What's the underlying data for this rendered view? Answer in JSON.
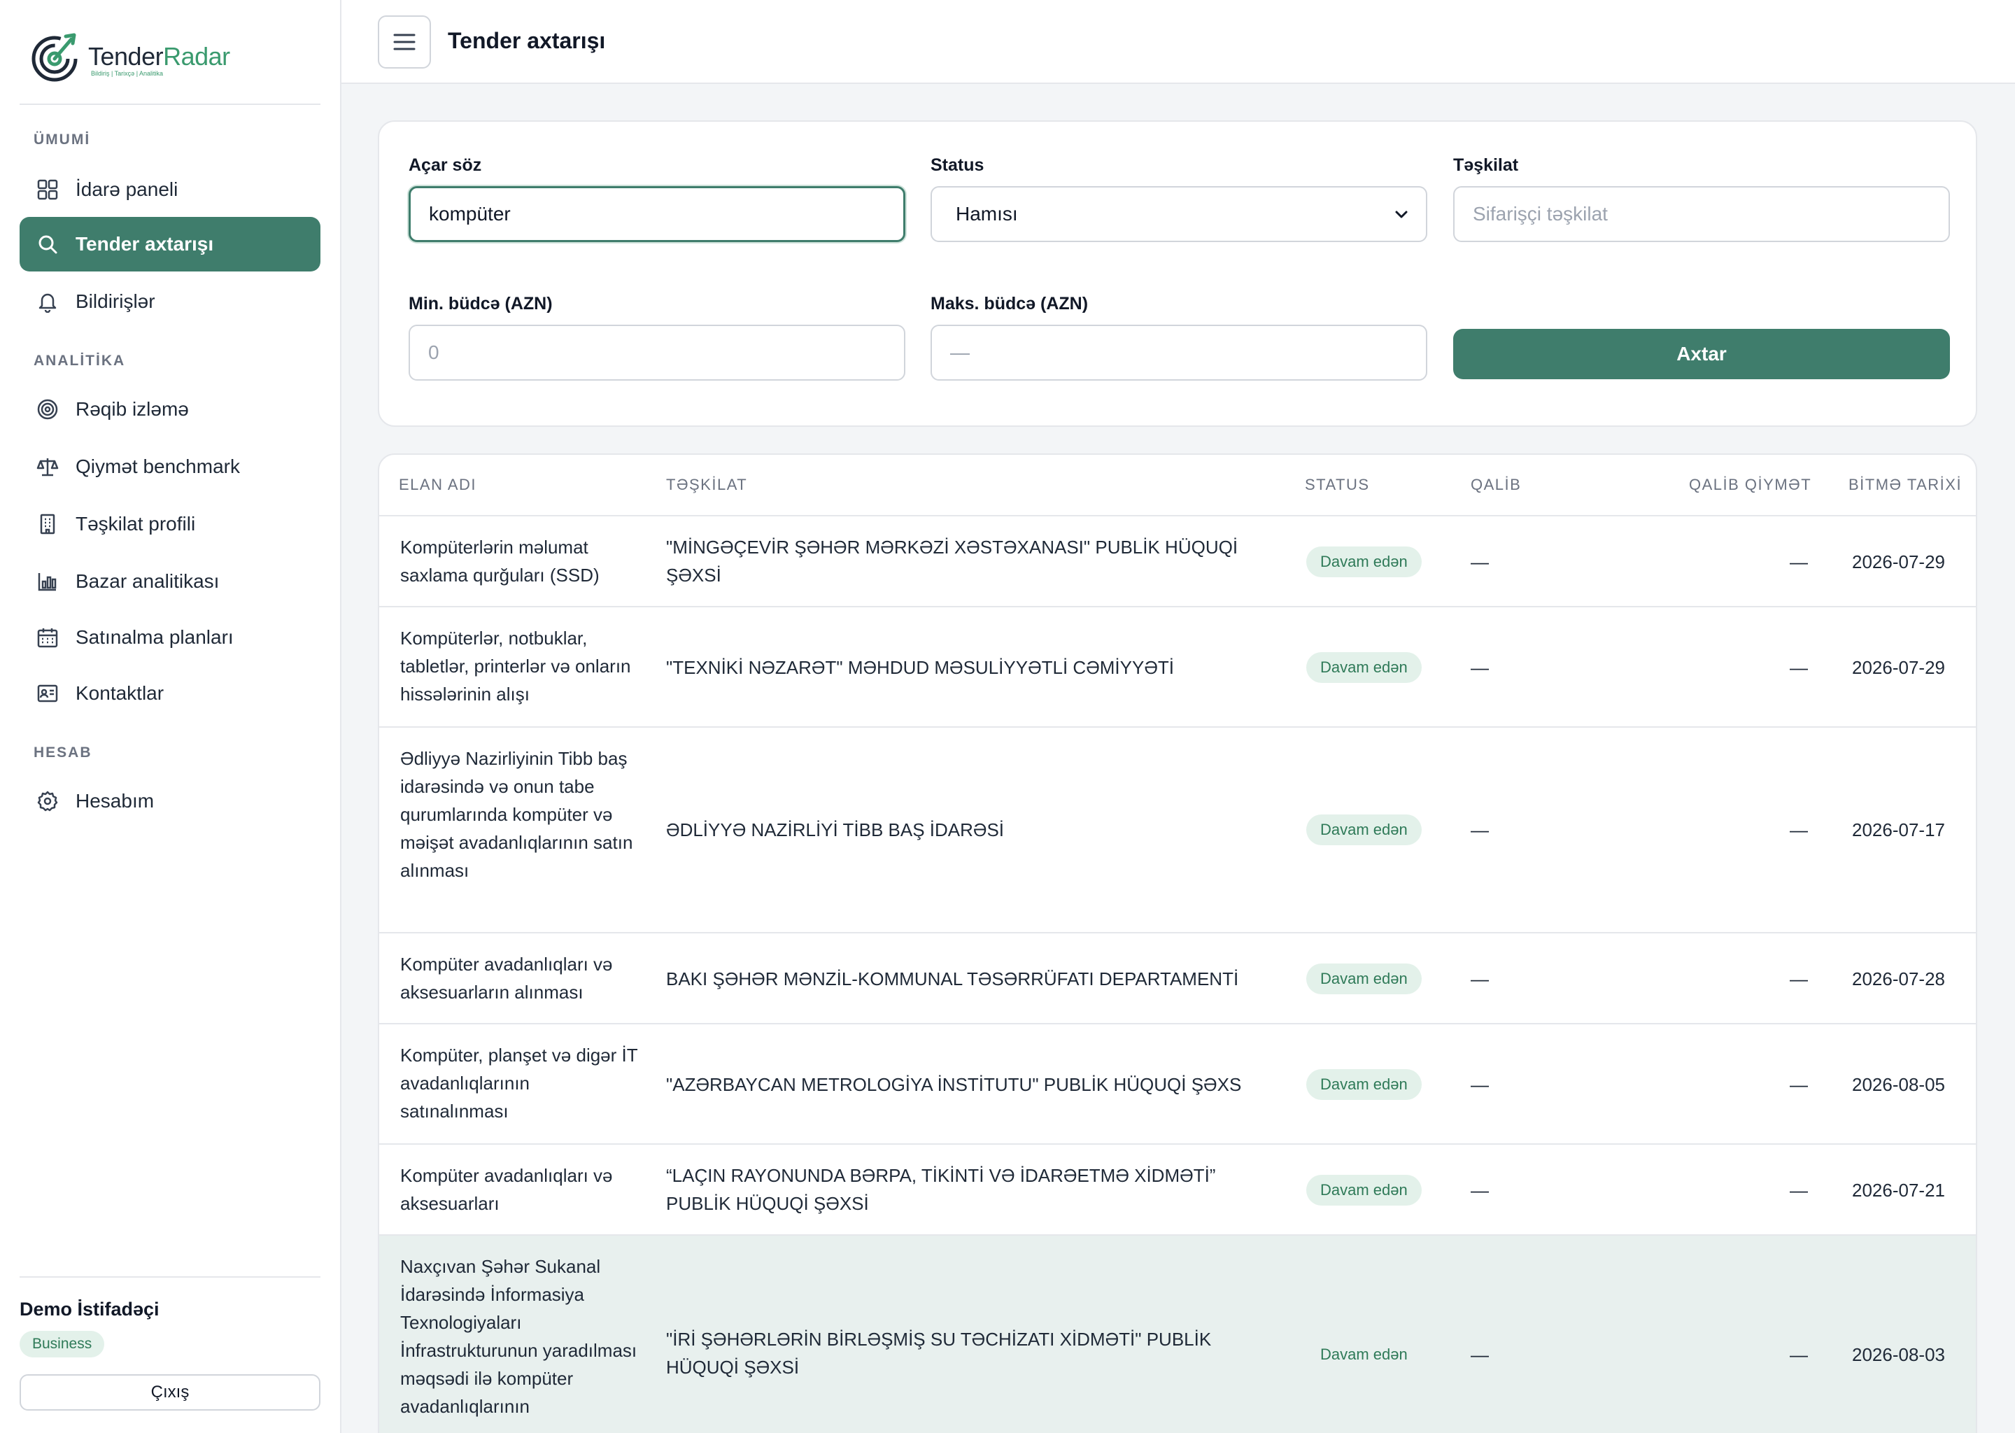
{
  "sidebar": {
    "logo": {
      "part1": "Tender",
      "part2": "Radar",
      "tagline": "Bildiriş  |  Tarixçə  |  Analitika"
    },
    "sections": [
      {
        "title": "ÜMUMİ",
        "items": [
          {
            "label": "İdarə paneli",
            "icon": "grid-icon"
          },
          {
            "label": "Tender axtarışı",
            "icon": "search-icon",
            "active": true
          },
          {
            "label": "Bildirişlər",
            "icon": "bell-icon"
          }
        ]
      },
      {
        "title": "ANALİTİKA",
        "items": [
          {
            "label": "Rəqib izləmə",
            "icon": "target-icon"
          },
          {
            "label": "Qiymət benchmark",
            "icon": "scale-icon"
          },
          {
            "label": "Təşkilat profili",
            "icon": "building-icon"
          },
          {
            "label": "Bazar analitikası",
            "icon": "bar-chart-icon"
          },
          {
            "label": "Satınalma planları",
            "icon": "calendar-icon"
          },
          {
            "label": "Kontaktlar",
            "icon": "contact-card-icon"
          }
        ]
      },
      {
        "title": "HESAB",
        "items": [
          {
            "label": "Hesabım",
            "icon": "gear-icon"
          }
        ]
      }
    ],
    "user": {
      "name": "Demo İstifadəçi",
      "plan": "Business",
      "logout_label": "Çıxış"
    }
  },
  "header": {
    "title": "Tender axtarışı"
  },
  "filters": {
    "keyword": {
      "label": "Açar söz",
      "value": "kompüter"
    },
    "status": {
      "label": "Status",
      "value": "Hamısı"
    },
    "organization": {
      "label": "Təşkilat",
      "placeholder": "Sifarişçi təşkilat"
    },
    "min_budget": {
      "label": "Min. büdcə (AZN)",
      "placeholder": "0"
    },
    "max_budget": {
      "label": "Maks. büdcə (AZN)",
      "placeholder": "—"
    },
    "search_label": "Axtar"
  },
  "table": {
    "columns": [
      "ELAN ADI",
      "TƏŞKİLAT",
      "STATUS",
      "QALİB",
      "QALİB QİYMƏT",
      "BİTMƏ TARİXİ"
    ],
    "rows": [
      {
        "name": "Kompüterlərin məlumat saxlama qurğuları (SSD)",
        "org": "\"MİNGƏÇEVİR ŞƏHƏR MƏRKƏZİ XƏSTƏXANASI\" PUBLİK HÜQUQİ ŞƏXSİ",
        "status": "Davam edən",
        "winner": "—",
        "price": "—",
        "date": "2026-07-29"
      },
      {
        "name": "Kompüterlər, notbuklar, tabletlər, printerlər və onların hissələrinin alışı",
        "org": "\"TEXNİKİ NƏZARƏT\" MƏHDUD MƏSULİYYƏTLİ CƏMİYYƏTİ",
        "status": "Davam edən",
        "winner": "—",
        "price": "—",
        "date": "2026-07-29"
      },
      {
        "name": "Ədliyyə Nazirliyinin Tibb baş idarəsində və onun tabe qurumlarında kompüter və məişət avadanlıqlarının satın alınması",
        "org": "ƏDLİYYƏ NAZİRLİYİ TİBB BAŞ İDARƏSİ",
        "status": "Davam edən",
        "winner": "—",
        "price": "—",
        "date": "2026-07-17"
      },
      {
        "name": "Kompüter avadanlıqları və aksesuarların alınması",
        "org": "BAKI ŞƏHƏR MƏNZİL-KOMMUNAL TƏSƏRRÜFATI DEPARTAMENTİ",
        "status": "Davam edən",
        "winner": "—",
        "price": "—",
        "date": "2026-07-28"
      },
      {
        "name": "Kompüter, planşet və digər İT avadanlıqlarının satınalınması",
        "org": "\"AZƏRBAYCAN METROLOGİYA İNSTİTUTU\" PUBLİK HÜQUQİ ŞƏXS",
        "status": "Davam edən",
        "winner": "—",
        "price": "—",
        "date": "2026-08-05"
      },
      {
        "name": "Kompüter avadanlıqları və aksesuarları",
        "org": "“LAÇIN RAYONUNDA BƏRPA, TİKİNTİ VƏ İDARƏETMƏ XİDMƏTİ” PUBLİK HÜQUQİ ŞƏXSİ",
        "status": "Davam edən",
        "winner": "—",
        "price": "—",
        "date": "2026-07-21"
      },
      {
        "name": "Naxçıvan Şəhər Sukanal İdarəsində İnformasiya Texnologiyaları İnfrastrukturunun yaradılması məqsədi ilə kompüter avadanlıqlarının",
        "org": "\"İRİ ŞƏHƏRLƏRİN BİRLƏŞMİŞ SU TƏCHİZATI XİDMƏTİ\" PUBLİK HÜQUQİ ŞƏXSİ",
        "status": "Davam edən",
        "winner": "—",
        "price": "—",
        "date": "2026-08-03"
      }
    ]
  }
}
